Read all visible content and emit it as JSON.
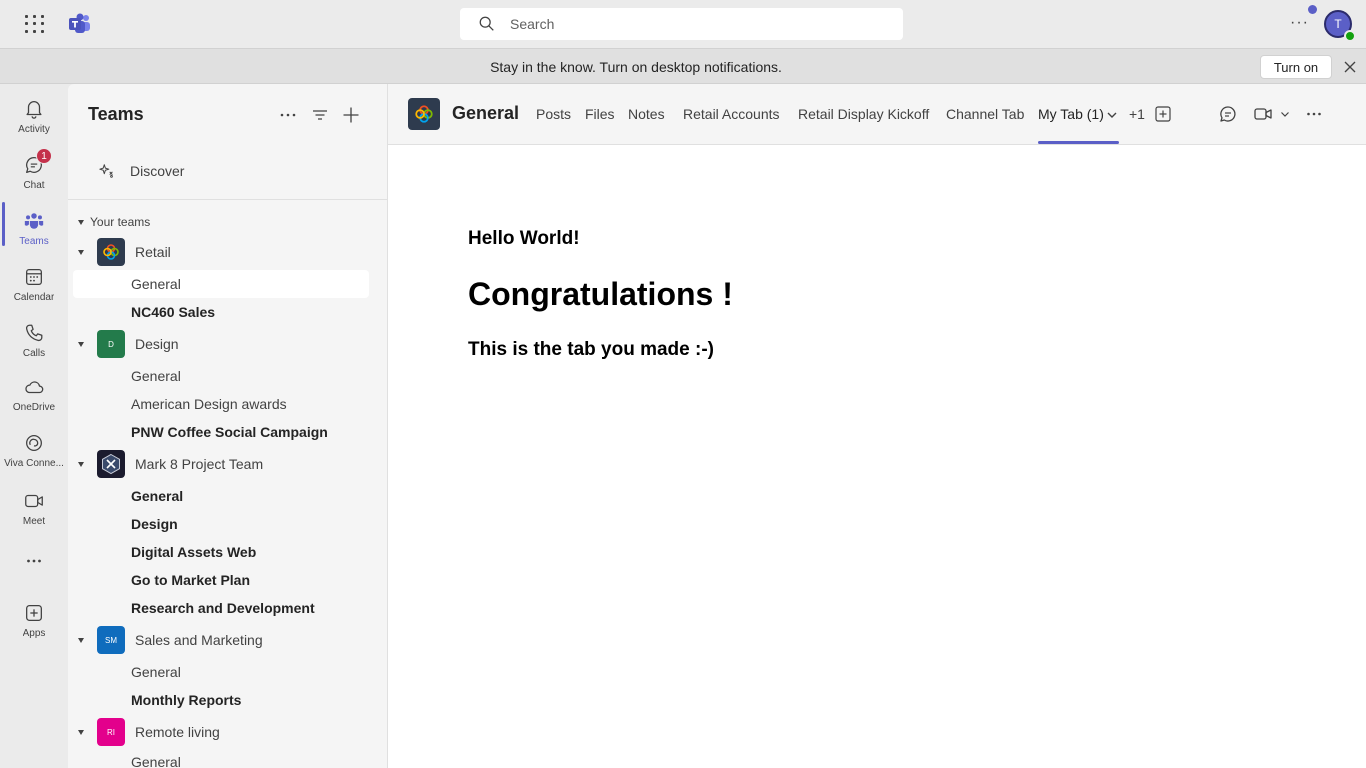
{
  "topbar": {
    "search_placeholder": "Search",
    "avatar_initial": "T",
    "more_label": "···"
  },
  "notification": {
    "text": "Stay in the know. Turn on desktop notifications.",
    "button": "Turn on"
  },
  "rail": {
    "items": [
      {
        "label": "Activity",
        "icon": "bell-icon"
      },
      {
        "label": "Chat",
        "icon": "chat-icon",
        "badge": "1"
      },
      {
        "label": "Teams",
        "icon": "teams-icon",
        "active": true
      },
      {
        "label": "Calendar",
        "icon": "calendar-icon"
      },
      {
        "label": "Calls",
        "icon": "phone-icon"
      },
      {
        "label": "OneDrive",
        "icon": "cloud-icon"
      },
      {
        "label": "Viva Conne...",
        "icon": "viva-connections-icon"
      },
      {
        "label": "Meet",
        "icon": "video-icon"
      },
      {
        "label": "",
        "icon": "more-icon"
      },
      {
        "label": "Apps",
        "icon": "apps-icon"
      }
    ]
  },
  "pane": {
    "title": "Teams",
    "discover": "Discover",
    "your_teams": "Your teams",
    "teams": [
      {
        "name": "Retail",
        "initials": "",
        "color": "#2e3b4e",
        "channels": [
          {
            "name": "General",
            "bold": false,
            "selected": true
          },
          {
            "name": "NC460 Sales",
            "bold": true
          }
        ]
      },
      {
        "name": "Design",
        "initials": "D",
        "color": "#237b4b",
        "channels": [
          {
            "name": "General",
            "bold": false
          },
          {
            "name": "American Design awards",
            "bold": false
          },
          {
            "name": "PNW Coffee Social Campaign",
            "bold": true
          }
        ]
      },
      {
        "name": "Mark 8 Project Team",
        "initials": "",
        "color": "#1b1b2e",
        "channels": [
          {
            "name": "General",
            "bold": true
          },
          {
            "name": "Design",
            "bold": true
          },
          {
            "name": "Digital Assets Web",
            "bold": true
          },
          {
            "name": "Go to Market Plan",
            "bold": true
          },
          {
            "name": "Research and Development",
            "bold": true
          }
        ]
      },
      {
        "name": "Sales and Marketing",
        "initials": "SM",
        "color": "#0f6cbd",
        "channels": [
          {
            "name": "General",
            "bold": false
          },
          {
            "name": "Monthly Reports",
            "bold": true
          }
        ]
      },
      {
        "name": "Remote living",
        "initials": "RI",
        "color": "#e3008c",
        "channels": [
          {
            "name": "General",
            "bold": false
          }
        ]
      }
    ]
  },
  "channel_header": {
    "title": "General",
    "tabs": [
      "Posts",
      "Files",
      "Notes",
      "Retail Accounts",
      "Retail Display Kickoff",
      "Channel Tab",
      "My Tab (1)",
      "+1"
    ],
    "active_tab": "My Tab (1)"
  },
  "content": {
    "hello": "Hello World!",
    "congrats": "Congratulations !",
    "made": "This is the tab you made :-)"
  },
  "colors": {
    "accent": "#5b5fc7",
    "badge": "#c4314b",
    "presence": "#13a10e"
  }
}
